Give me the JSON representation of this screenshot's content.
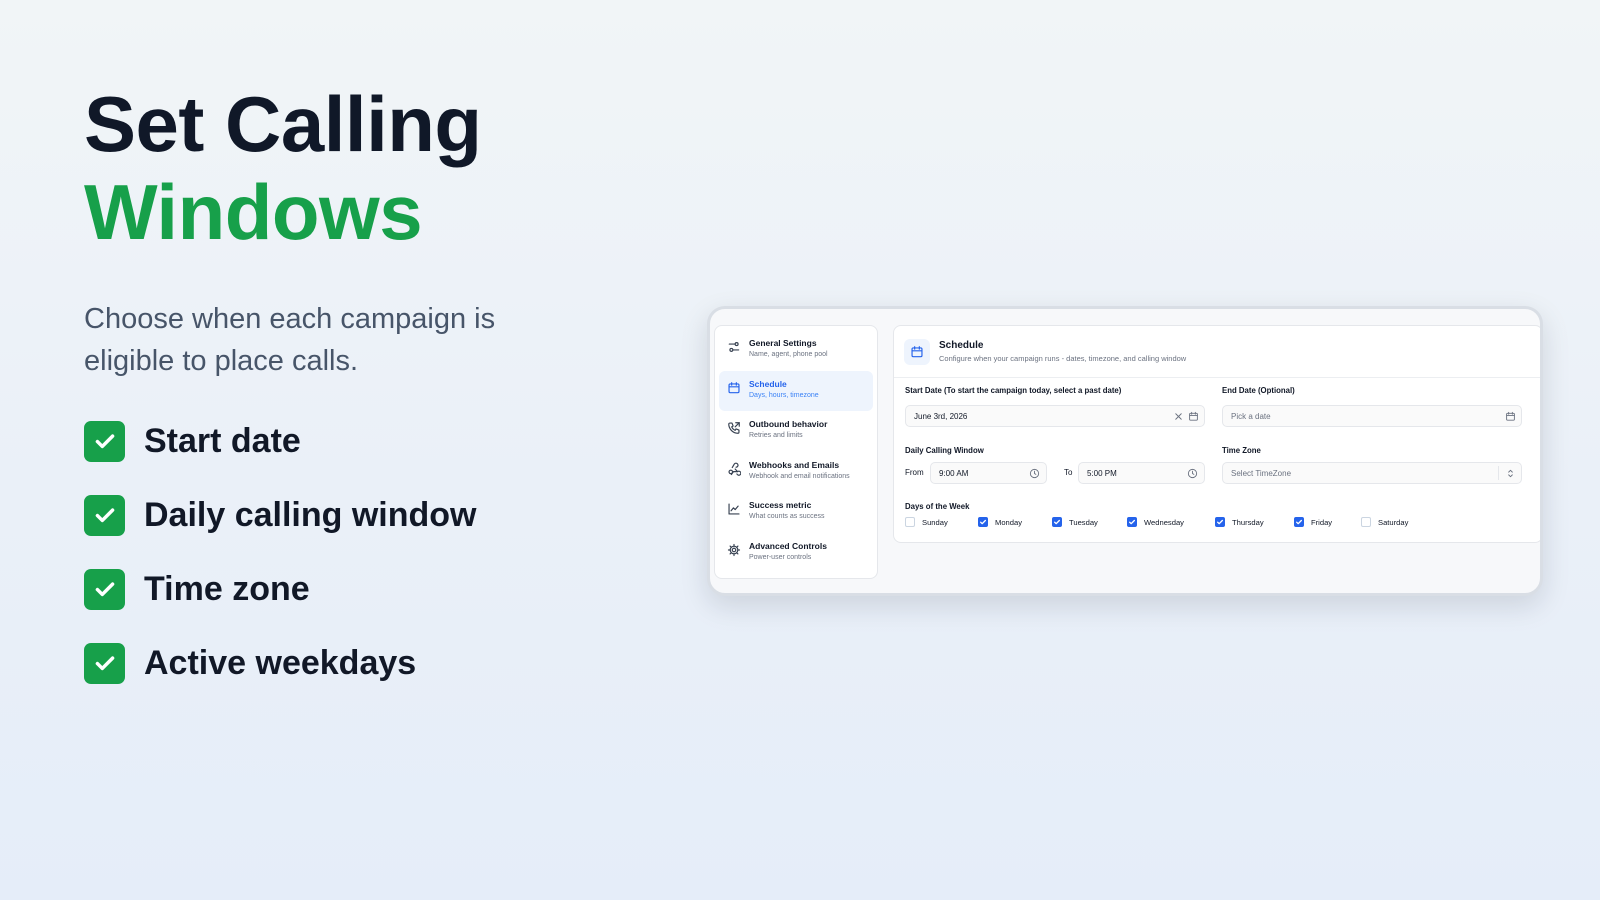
{
  "hero": {
    "title_line1": "Set Calling",
    "title_line2": "Windows",
    "subtitle": "Choose when each campaign is eligible to place calls.",
    "features": [
      "Start date",
      "Daily calling window",
      "Time zone",
      "Active weekdays"
    ]
  },
  "colors": {
    "accent_green": "#17a04a",
    "accent_blue": "#2563eb"
  },
  "sidebar": {
    "items": [
      {
        "title": "General Settings",
        "desc": "Name, agent, phone pool",
        "icon": "sliders-icon"
      },
      {
        "title": "Schedule",
        "desc": "Days, hours, timezone",
        "icon": "calendar-icon",
        "active": true
      },
      {
        "title": "Outbound behavior",
        "desc": "Retries and limits",
        "icon": "phone-outgoing-icon"
      },
      {
        "title": "Webhooks and Emails",
        "desc": "Webhook and email notifications",
        "icon": "webhook-icon"
      },
      {
        "title": "Success metric",
        "desc": "What counts as success",
        "icon": "chart-icon"
      },
      {
        "title": "Advanced Controls",
        "desc": "Power-user controls",
        "icon": "gear-icon"
      }
    ]
  },
  "main": {
    "title": "Schedule",
    "description": "Configure when your campaign runs - dates, timezone, and calling window",
    "start_date": {
      "label": "Start Date (To start the campaign today, select a past date)",
      "value": "June 3rd, 2026"
    },
    "end_date": {
      "label": "End Date (Optional)",
      "placeholder": "Pick a date"
    },
    "calling_window": {
      "label": "Daily Calling Window",
      "from_label": "From",
      "from_value": "9:00 AM",
      "to_label": "To",
      "to_value": "5:00 PM"
    },
    "time_zone": {
      "label": "Time Zone",
      "placeholder": "Select TimeZone"
    },
    "days": {
      "label": "Days of the Week",
      "items": [
        {
          "name": "Sunday",
          "checked": false
        },
        {
          "name": "Monday",
          "checked": true
        },
        {
          "name": "Tuesday",
          "checked": true
        },
        {
          "name": "Wednesday",
          "checked": true
        },
        {
          "name": "Thursday",
          "checked": true
        },
        {
          "name": "Friday",
          "checked": true
        },
        {
          "name": "Saturday",
          "checked": false
        }
      ]
    }
  }
}
